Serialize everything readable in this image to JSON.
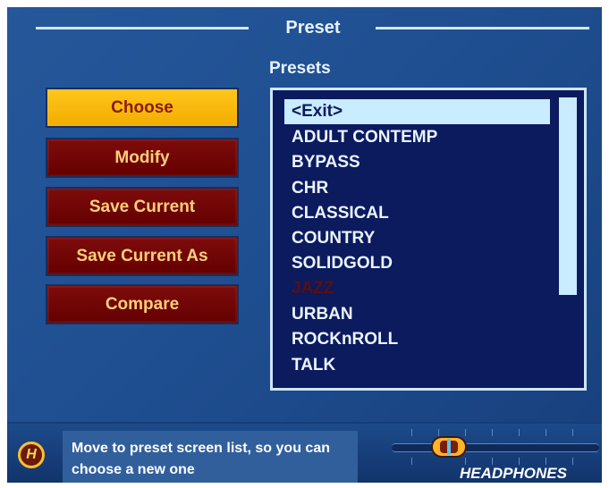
{
  "header": {
    "title": "Preset",
    "list_title": "Presets"
  },
  "buttons": [
    {
      "label": "Choose",
      "state": "selected"
    },
    {
      "label": "Modify",
      "state": "normal"
    },
    {
      "label": "Save Current",
      "state": "normal"
    },
    {
      "label": "Save Current As",
      "state": "normal"
    },
    {
      "label": "Compare",
      "state": "normal"
    }
  ],
  "presets": [
    {
      "label": "<Exit>",
      "state": "selected"
    },
    {
      "label": "ADULT CONTEMP",
      "state": "normal"
    },
    {
      "label": "BYPASS",
      "state": "normal"
    },
    {
      "label": "CHR",
      "state": "normal"
    },
    {
      "label": "CLASSICAL",
      "state": "normal"
    },
    {
      "label": "COUNTRY",
      "state": "normal"
    },
    {
      "label": "SOLIDGOLD",
      "state": "normal"
    },
    {
      "label": "JAZZ",
      "state": "disabled"
    },
    {
      "label": "URBAN",
      "state": "normal"
    },
    {
      "label": "ROCKnROLL",
      "state": "normal"
    },
    {
      "label": "TALK",
      "state": "normal"
    }
  ],
  "help": {
    "icon": "H",
    "line1": "Move to preset screen list, so you can",
    "line2": "choose a new one"
  },
  "volume": {
    "label": "HEADPHONES",
    "level": 0.27
  },
  "colors": {
    "background": "#1f4f91",
    "button_red": "#6d0505",
    "button_selected": "#ffbe10",
    "list_bg": "#0c1a5e",
    "highlight": "#c9ecff"
  }
}
